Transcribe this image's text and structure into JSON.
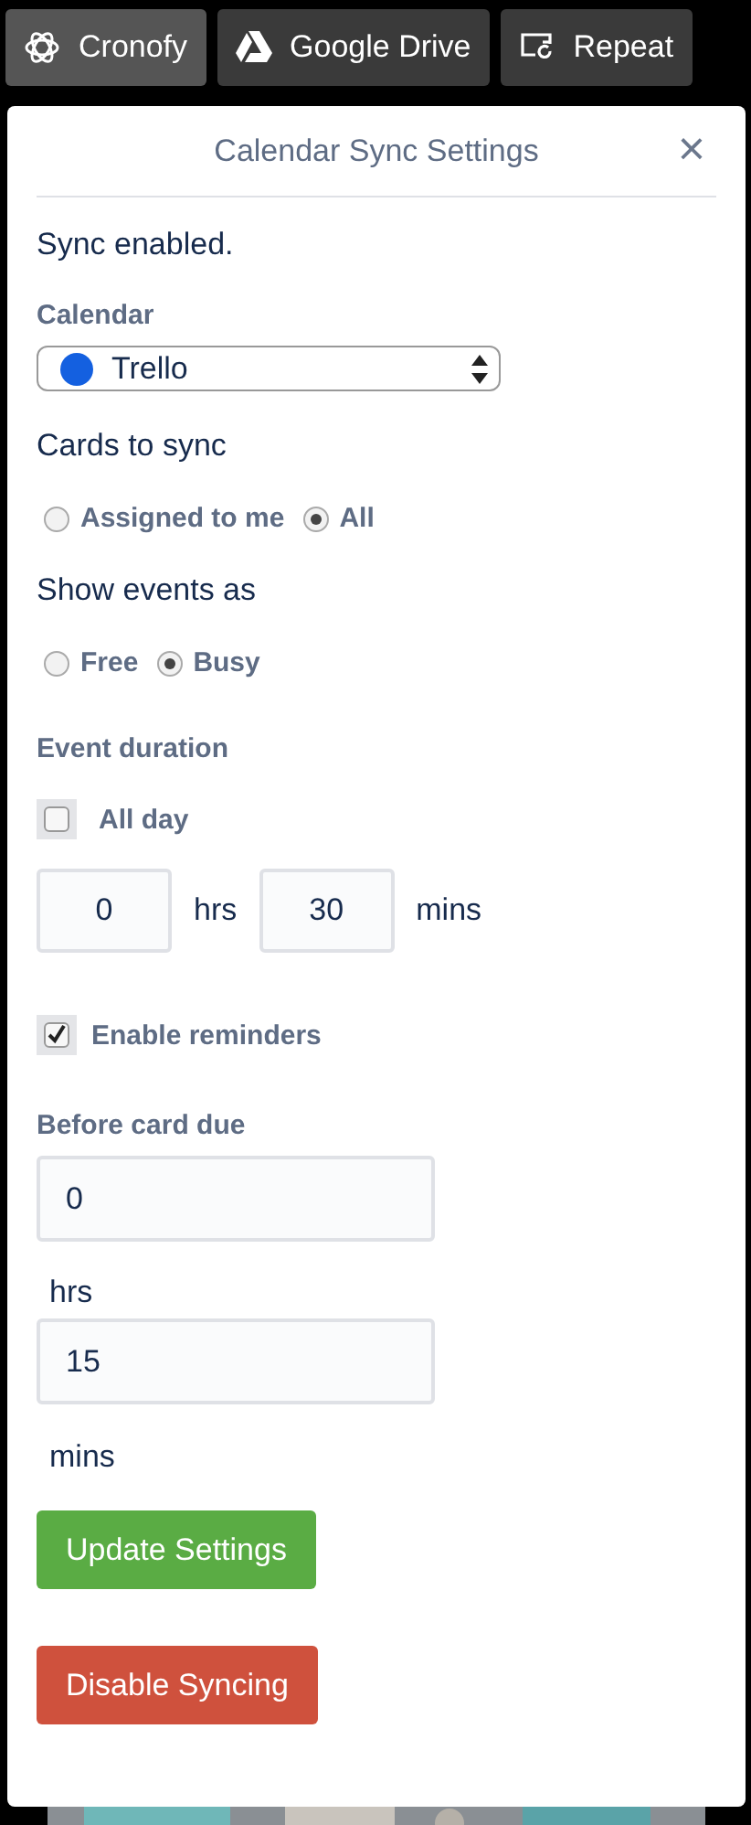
{
  "toolbar": [
    {
      "label": "Cronofy",
      "kind": "atom",
      "selected": true
    },
    {
      "label": "Google Drive",
      "kind": "drive",
      "selected": false
    },
    {
      "label": "Repeat",
      "kind": "repeat",
      "selected": false
    }
  ],
  "popup": {
    "title": "Calendar Sync Settings",
    "close": "×",
    "status": "Sync enabled.",
    "calendar": {
      "label": "Calendar",
      "value": "Trello",
      "color": "#1460e0"
    },
    "cards_to_sync": {
      "label": "Cards to sync",
      "options": [
        {
          "label": "Assigned to me",
          "selected": false
        },
        {
          "label": "All",
          "selected": true
        }
      ]
    },
    "show_events_as": {
      "label": "Show events as",
      "options": [
        {
          "label": "Free",
          "selected": false
        },
        {
          "label": "Busy",
          "selected": true
        }
      ]
    },
    "event_duration": {
      "label": "Event duration",
      "all_day": {
        "label": "All day",
        "checked": false
      },
      "hours": "0",
      "hours_unit": "hrs",
      "minutes": "30",
      "minutes_unit": "mins"
    },
    "reminders": {
      "label": "Enable reminders",
      "checked": true
    },
    "before_due": {
      "label": "Before card due",
      "hours": "0",
      "hours_unit": "hrs",
      "minutes": "15",
      "minutes_unit": "mins"
    },
    "buttons": [
      {
        "label": "Update Settings",
        "kind": "primary"
      },
      {
        "label": "Disable Syncing",
        "kind": "danger"
      }
    ]
  }
}
